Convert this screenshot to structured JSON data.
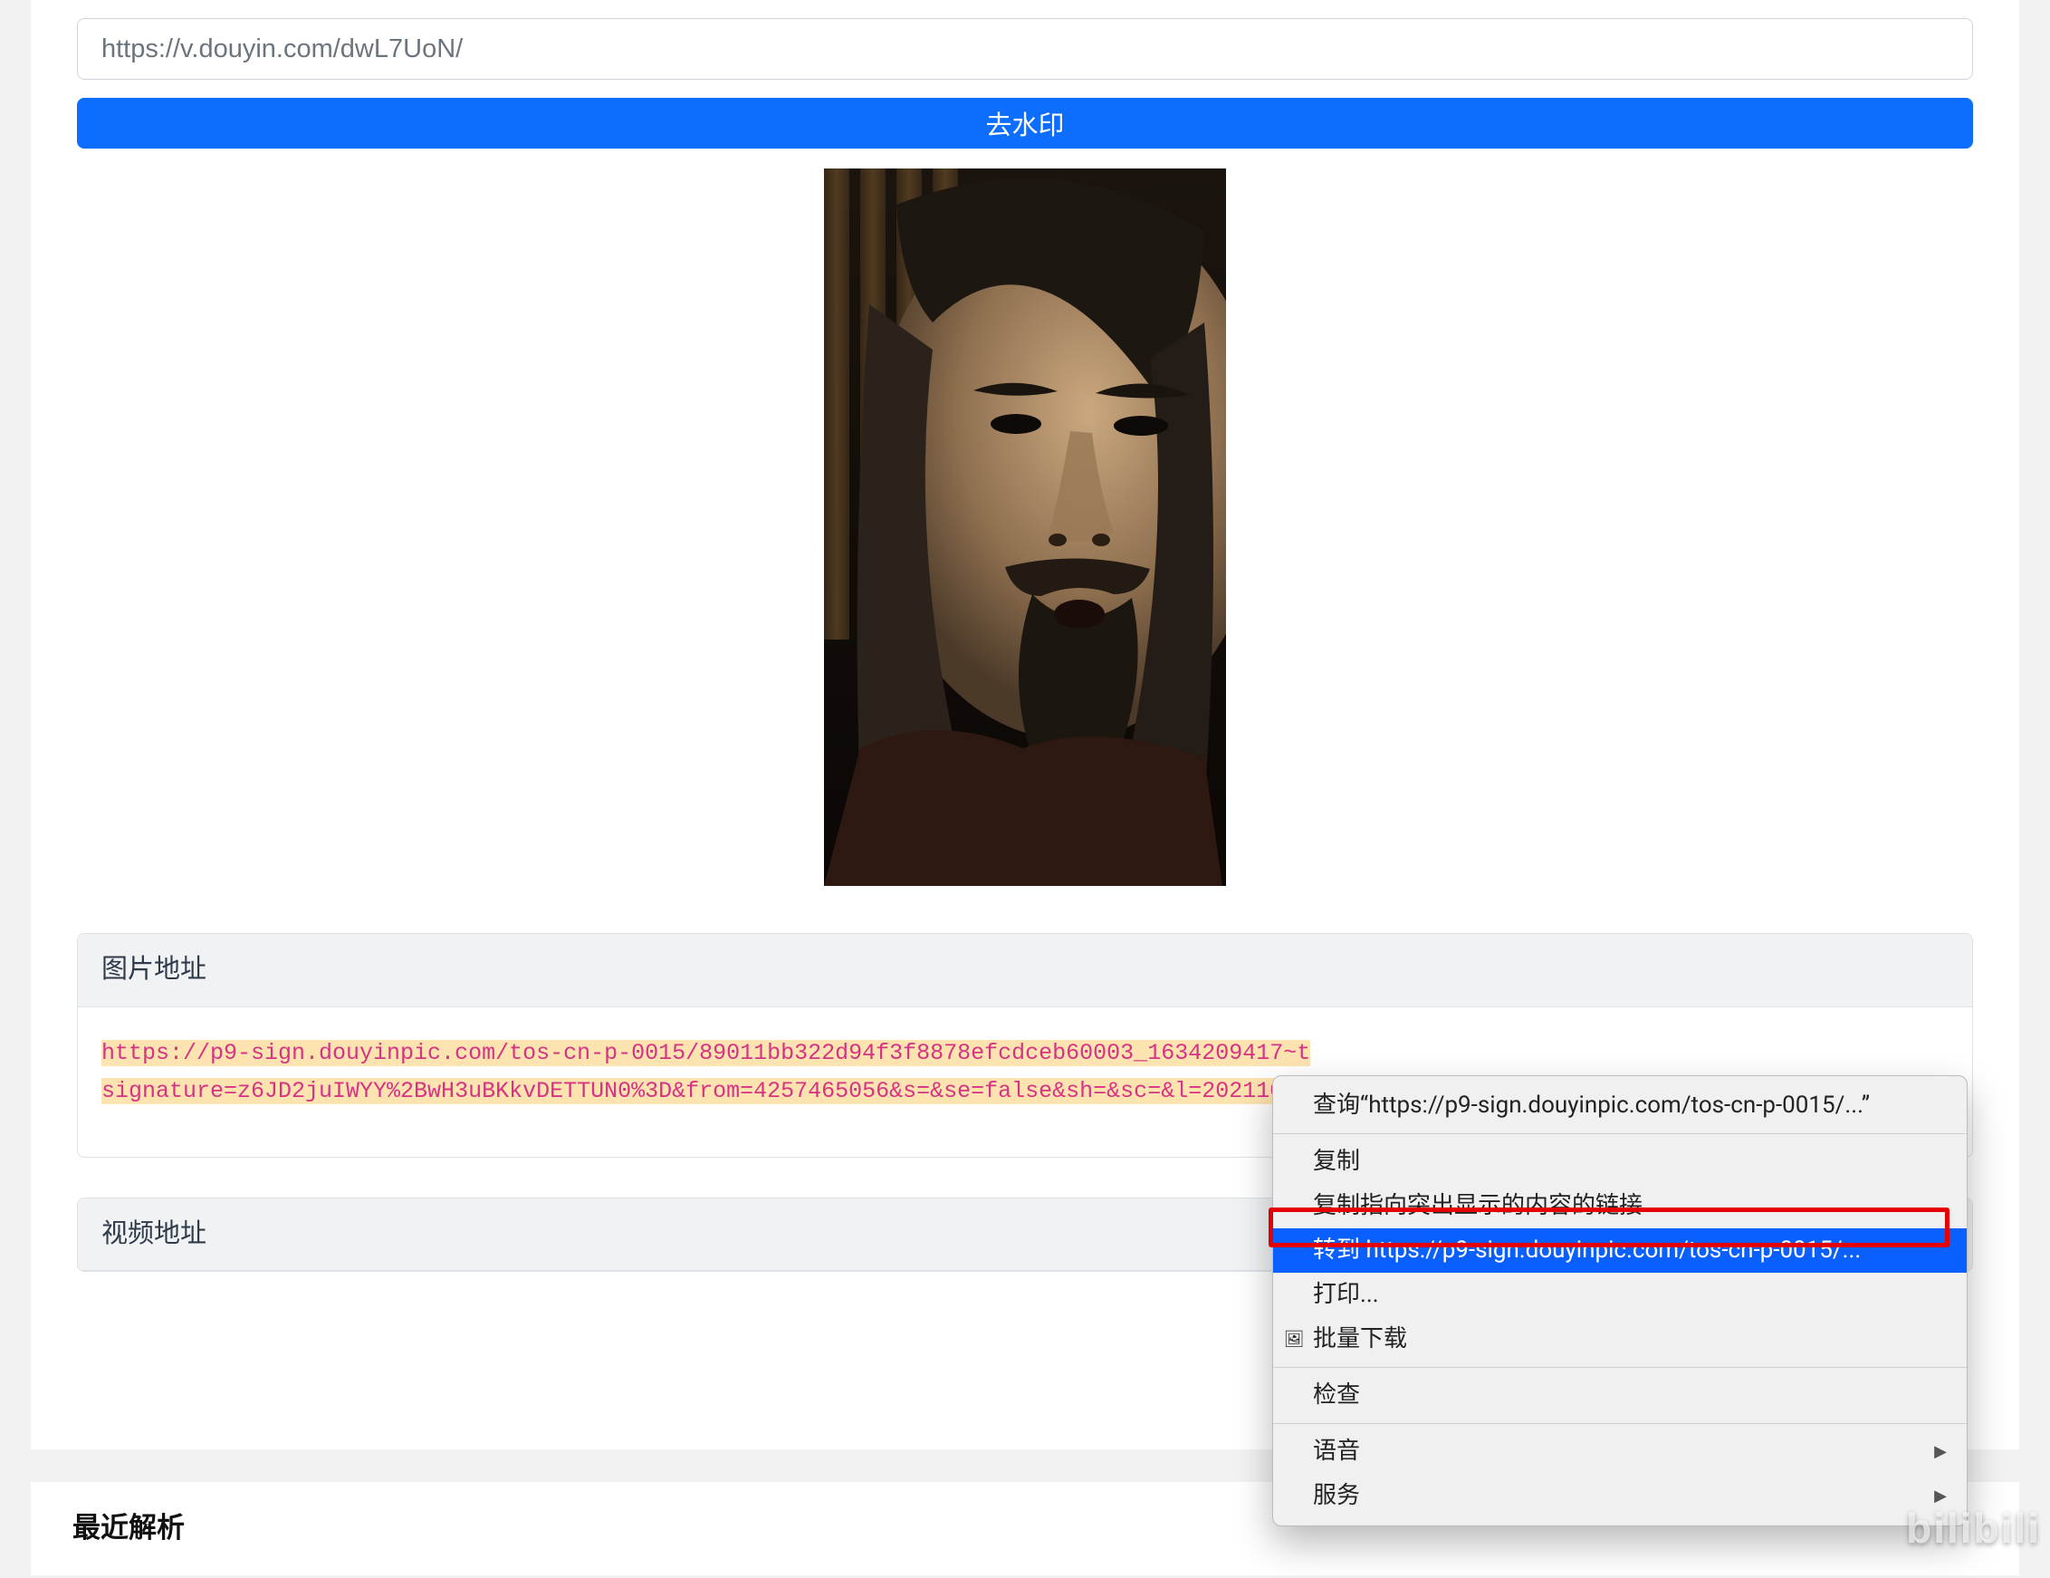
{
  "url_input": {
    "value": "https://v.douyin.com/dwL7UoN/"
  },
  "buttons": {
    "remove_watermark": "去水印"
  },
  "panels": {
    "image_url": {
      "title": "图片地址",
      "url_line1": "https://p9-sign.douyinpic.com/tos-cn-p-0015/89011bb322d94f3f8878efcdceb60003_1634209417~t",
      "url_line2": "signature=z6JD2juIWYY%2BwH3uBKkvDETTUN0%3D&from=4257465056&s=&se=false&sh=&sc=&l=2021102"
    },
    "video_url": {
      "title": "视频地址"
    }
  },
  "context_menu": {
    "query": "查询“https://p9-sign.douyinpic.com/tos-cn-p-0015/...”",
    "copy": "复制",
    "copy_link": "复制指向突出显示的内容的链接",
    "goto": "转到 https://p9-sign.douyinpic.com/tos-cn-p-0015/...",
    "print": "打印...",
    "batch_download": "批量下载",
    "inspect": "检查",
    "voice": "语音",
    "services": "服务"
  },
  "recent": {
    "title": "最近解析"
  },
  "watermark": "bilibili"
}
